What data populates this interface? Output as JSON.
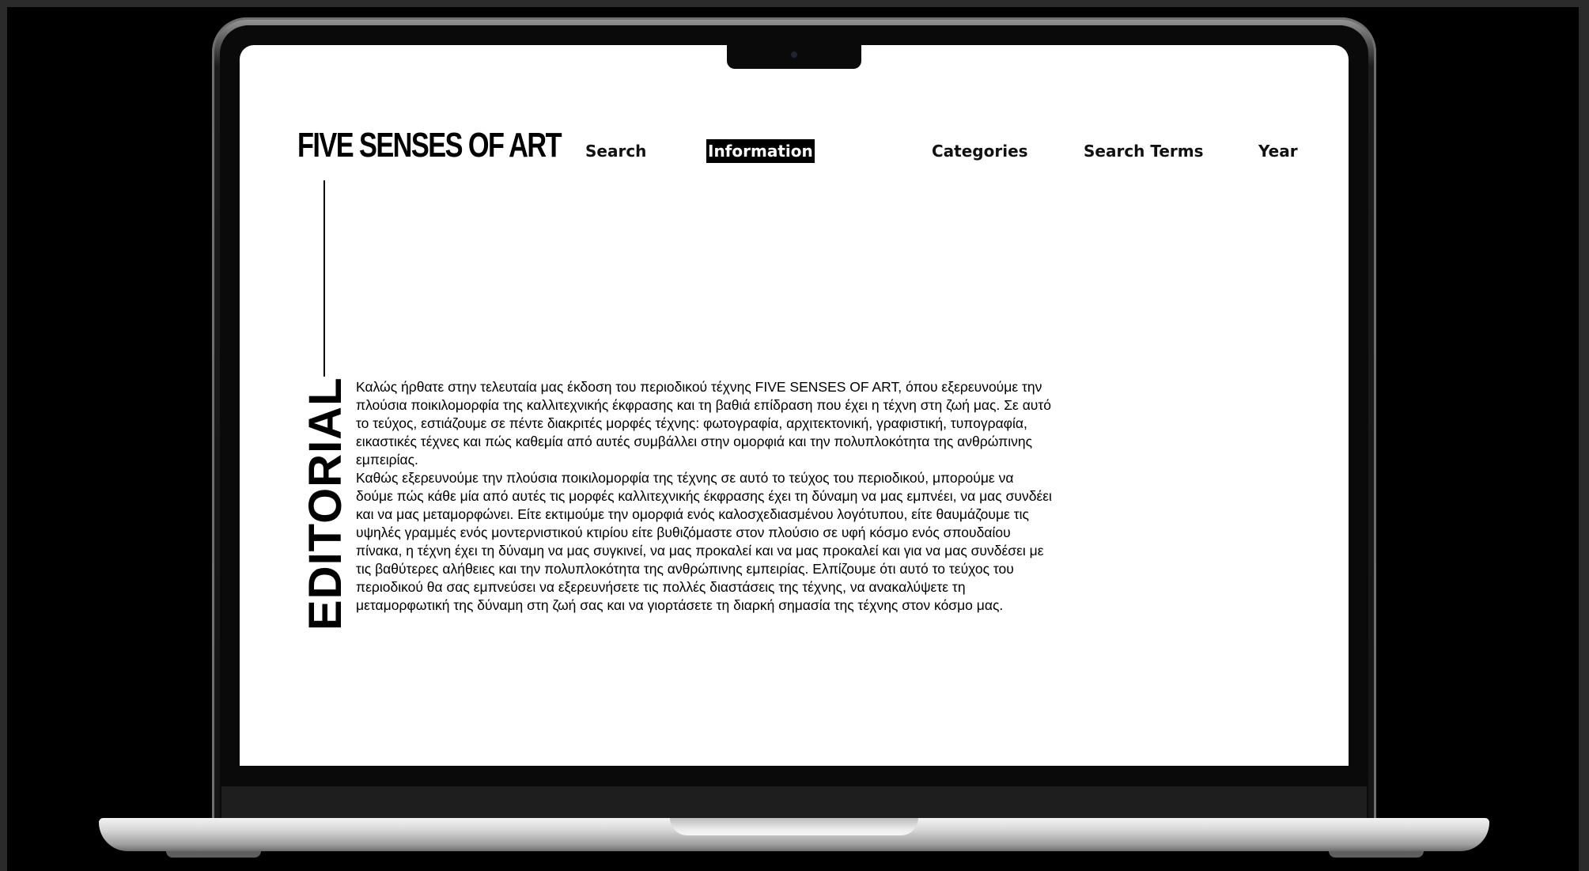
{
  "site": {
    "brand": "FIVE SENSES OF ART"
  },
  "nav": {
    "items": [
      {
        "label": "Search",
        "active": false
      },
      {
        "label": "Information",
        "active": true
      },
      {
        "label": "Categories",
        "active": false
      },
      {
        "label": "Search Terms",
        "active": false
      },
      {
        "label": "Year",
        "active": false
      }
    ]
  },
  "editorial": {
    "heading": "EDITORIAL",
    "paragraphs": [
      "Καλώς ήρθατε στην τελευταία μας έκδοση του περιοδικού τέχνης FIVE SENSES OF ART, όπου εξερευνούμε την πλούσια ποικιλομορφία της καλλιτεχνικής έκφρασης και τη βαθιά επίδραση που έχει η τέχνη στη ζωή μας. Σε αυτό το τεύχος, εστιάζουμε σε πέντε διακριτές μορφές τέχνης: φωτογραφία, αρχιτεκτονική, γραφιστική, τυπογραφία, εικαστικές τέχνες και πώς καθεμία από αυτές συμβάλλει στην ομορφιά και την πολυπλοκότητα της ανθρώπινης εμπειρίας.",
      "Καθώς εξερευνούμε την πλούσια ποικιλομορφία της τέχνης σε αυτό το τεύχος του περιοδικού, μπορούμε να δούμε πώς κάθε μία από αυτές τις μορφές καλλιτεχνικής έκφρασης έχει τη δύναμη να μας εμπνέει, να μας συνδέει και να μας μεταμορφώνει. Είτε εκτιμούμε την ομορφιά ενός καλοσχεδιασμένου λογότυπου, είτε θαυμάζουμε τις υψηλές γραμμές ενός μοντερνιστικού κτιρίου είτε βυθιζόμαστε στον πλούσιο σε υφή κόσμο ενός σπουδαίου πίνακα, η τέχνη έχει τη δύναμη να μας συγκινεί, να μας προκαλεί και να μας προκαλεί και για να μας συνδέσει με τις βαθύτερες αλήθειες και την πολυπλοκότητα της ανθρώπινης εμπειρίας. Ελπίζουμε ότι αυτό το τεύχος του περιοδικού θα σας εμπνεύσει να εξερευνήσετε τις πολλές διαστάσεις της τέχνης, να ανακαλύψετε τη μεταμορφωτική της δύναμη στη ζωή σας και να γιορτάσετε τη διαρκή σημασία της τέχνης στον κόσμο μας."
    ]
  },
  "colors": {
    "background": "#000000",
    "screen": "#ffffff",
    "text": "#000000",
    "active_nav_bg": "#000000",
    "active_nav_text": "#ffffff"
  }
}
